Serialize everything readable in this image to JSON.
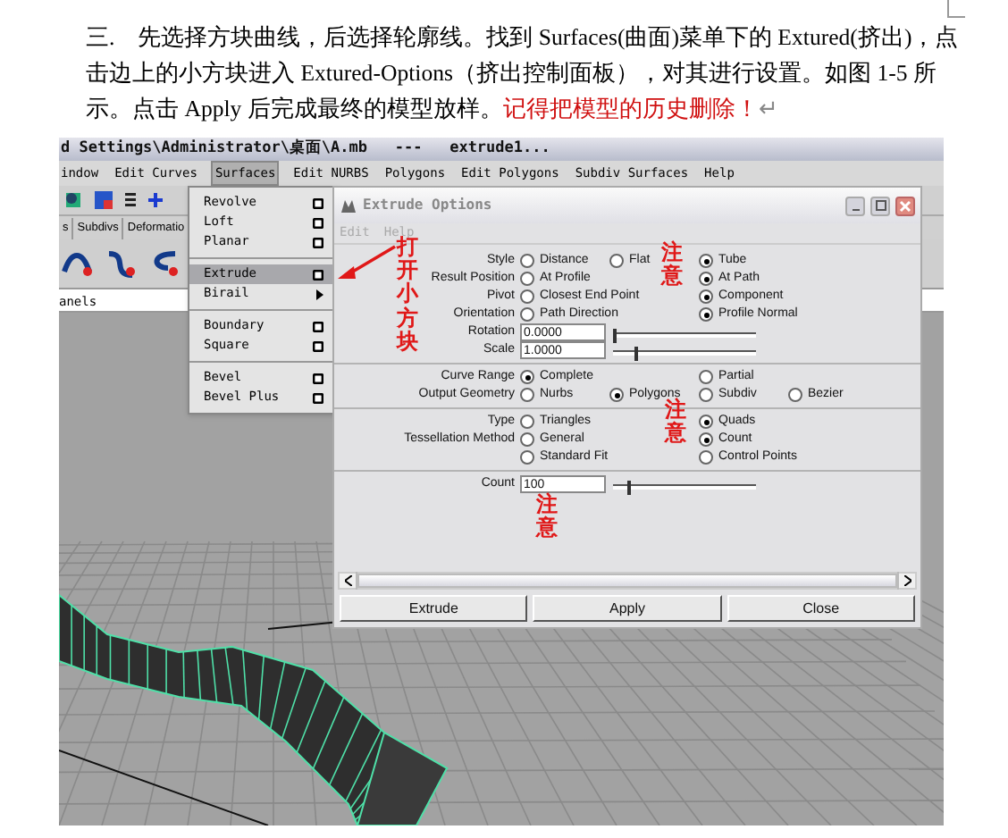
{
  "paragraph": {
    "text": "三.　先选择方块曲线，后选择轮廓线。找到 Surfaces(曲面)菜单下的 Extured(挤出)，点击边上的小方块进入 Extured-Options（挤出控制面板），对其进行设置。如图 1-5 所示。点击 Apply 后完成最终的模型放样。",
    "highlight": "记得把模型的历史删除！",
    "mark": "↵"
  },
  "maya": {
    "title": "d Settings\\Administrator\\桌面\\A.mb   ---   extrude1...",
    "menus": [
      {
        "label": "indow",
        "selected": false
      },
      {
        "label": "Edit Curves",
        "selected": false
      },
      {
        "label": "Surfaces",
        "selected": true
      },
      {
        "label": "Edit NURBS",
        "selected": false
      },
      {
        "label": "Polygons",
        "selected": false
      },
      {
        "label": "Edit Polygons",
        "selected": false
      },
      {
        "label": "Subdiv Surfaces",
        "selected": false
      },
      {
        "label": "Help",
        "selected": false
      }
    ],
    "shelf_tabs": [
      "s",
      "Subdivs",
      "Deformatio"
    ],
    "panel_label": "anels",
    "surfaces_menu": [
      {
        "kind": "item",
        "label": "Revolve",
        "selected": false
      },
      {
        "kind": "item",
        "label": "Loft",
        "selected": false
      },
      {
        "kind": "item",
        "label": "Planar",
        "selected": false
      },
      {
        "kind": "separator"
      },
      {
        "kind": "item",
        "label": "Extrude",
        "selected": true
      },
      {
        "kind": "submenu",
        "label": "Birail",
        "selected": false
      },
      {
        "kind": "separator"
      },
      {
        "kind": "item",
        "label": "Boundary",
        "selected": false
      },
      {
        "kind": "item",
        "label": "Square",
        "selected": false
      },
      {
        "kind": "separator"
      },
      {
        "kind": "item",
        "label": "Bevel",
        "selected": false
      },
      {
        "kind": "item",
        "label": "Bevel Plus",
        "selected": false
      }
    ]
  },
  "dialog": {
    "title": "Extrude Options",
    "menu": [
      {
        "label": "Edit",
        "disabled": true
      },
      {
        "label": "Help",
        "disabled": true
      }
    ],
    "sections": [
      [
        {
          "kind": "radio",
          "label": "Style",
          "options": [
            {
              "label": "Distance",
              "selected": false
            },
            {
              "label": "Flat",
              "selected": false
            }
          ],
          "right_options": [
            {
              "label": "Tube",
              "selected": true
            }
          ]
        },
        {
          "kind": "radio",
          "label": "Result Position",
          "options": [
            {
              "label": "At Profile",
              "selected": false
            }
          ],
          "right_options": [
            {
              "label": "At Path",
              "selected": true
            }
          ]
        },
        {
          "kind": "radio",
          "label": "Pivot",
          "options": [
            {
              "label": "Closest End Point",
              "selected": false
            }
          ],
          "right_options": [
            {
              "label": "Component",
              "selected": true
            }
          ]
        },
        {
          "kind": "radio",
          "label": "Orientation",
          "options": [
            {
              "label": "Path Direction",
              "selected": false
            }
          ],
          "right_options": [
            {
              "label": "Profile Normal",
              "selected": true
            }
          ]
        },
        {
          "kind": "field",
          "label": "Rotation",
          "value": "0.0000",
          "level": 0.0
        },
        {
          "kind": "field",
          "label": "Scale",
          "value": "1.0000",
          "level": 0.15
        }
      ],
      [
        {
          "kind": "radio",
          "label": "Curve Range",
          "options": [
            {
              "label": "Complete",
              "selected": true
            }
          ],
          "right_options": [
            {
              "label": "Partial",
              "selected": false
            }
          ]
        },
        {
          "kind": "radio",
          "label": "Output Geometry",
          "options": [
            {
              "label": "Nurbs",
              "selected": false
            },
            {
              "label": "Polygons",
              "selected": true
            }
          ],
          "right_options": [
            {
              "label": "Subdiv",
              "selected": false
            },
            {
              "label": "Bezier",
              "selected": false
            }
          ]
        }
      ],
      [
        {
          "kind": "radio",
          "label": "Type",
          "options": [
            {
              "label": "Triangles",
              "selected": false
            }
          ],
          "right_options": [
            {
              "label": "Quads",
              "selected": true
            }
          ]
        },
        {
          "kind": "radio",
          "label": "Tessellation Method",
          "options": [
            {
              "label": "General",
              "selected": false
            }
          ],
          "right_options": [
            {
              "label": "Count",
              "selected": true
            }
          ]
        },
        {
          "kind": "radio",
          "options": [
            {
              "label": "Standard Fit",
              "selected": false
            }
          ],
          "right_options": [
            {
              "label": "Control Points",
              "selected": false
            }
          ]
        }
      ],
      [
        {
          "kind": "field",
          "label": "Count",
          "value": "100",
          "level": 0.1
        }
      ]
    ],
    "buttons": [
      "Extrude",
      "Apply",
      "Close"
    ]
  },
  "annotations": [
    "打开小方块",
    "注意",
    "注意",
    "注意"
  ]
}
